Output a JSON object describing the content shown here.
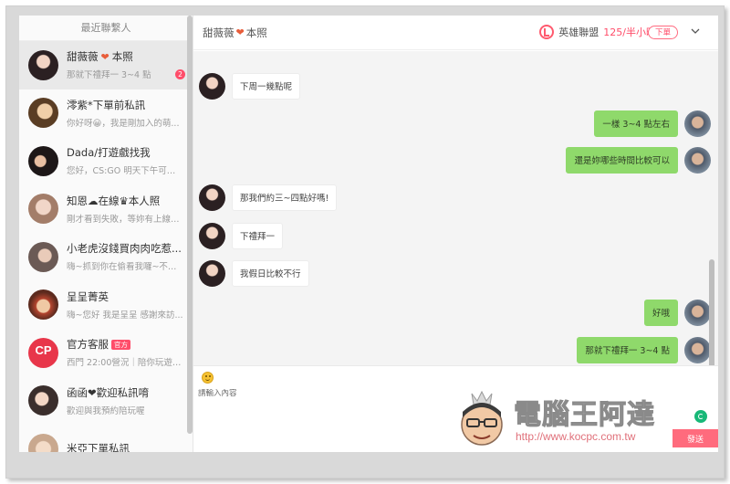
{
  "sidebar": {
    "header": "最近聯繫人",
    "contacts": [
      {
        "name": "甜薇薇",
        "name_suffix": "本照",
        "preview": "那就下禮拜一 3~4 點",
        "unread": "2",
        "active": true
      },
      {
        "name": "澪紫*下單前私訊",
        "preview": "你好呀😀，我是剛加入的萌..."
      },
      {
        "name": "Dada/打遊戲找我",
        "preview": "您好，CS:GO 明天下午可以..."
      },
      {
        "name": "知恩☁在線♛本人照",
        "preview": "剛才看到失敗，等妳有上線可..."
      },
      {
        "name": "小老虎沒錢買肉肉吃惹...",
        "preview": "嗨~抓到你在偷看我囉~不下..."
      },
      {
        "name": "呈呈菁英",
        "preview": "嗨~您好 我是呈呈 感謝來訪..."
      },
      {
        "name": "官方客服",
        "tag": "官方",
        "preview": "西門 22:00營況｜陪你玩遊戲..."
      },
      {
        "name": "函函❤歡迎私訊唷",
        "preview": "歡迎與我預約陪玩喔"
      },
      {
        "name": "米亞下單私訊",
        "preview": ""
      }
    ]
  },
  "chat": {
    "title_name": "甜薇薇",
    "title_suffix": "本照",
    "game_name": "英雄聯盟",
    "game_price": "125/半小時",
    "order_label": "下單",
    "messages": [
      {
        "side": "left",
        "text": "下周一幾點呢"
      },
      {
        "side": "right",
        "text": "一樣 3~4 點左右"
      },
      {
        "side": "right",
        "text": "還是妳哪些時間比較可以"
      },
      {
        "side": "left",
        "text": "那我們約三~四點好嗎!"
      },
      {
        "side": "left",
        "text": "下禮拜一"
      },
      {
        "side": "left",
        "text": "我假日比較不行"
      },
      {
        "side": "right",
        "text": "好哦"
      },
      {
        "side": "right",
        "text": "那就下禮拜一 3~4 點"
      }
    ],
    "input_placeholder": "請輸入內容",
    "send_label": "發送"
  },
  "watermark": {
    "title": "電腦王阿達",
    "url": "http://www.kocpc.com.tw"
  },
  "colors": {
    "accent": "#ff4d6a",
    "bubble_self": "#8fd96b",
    "chat_bg": "#f4f4f4"
  }
}
